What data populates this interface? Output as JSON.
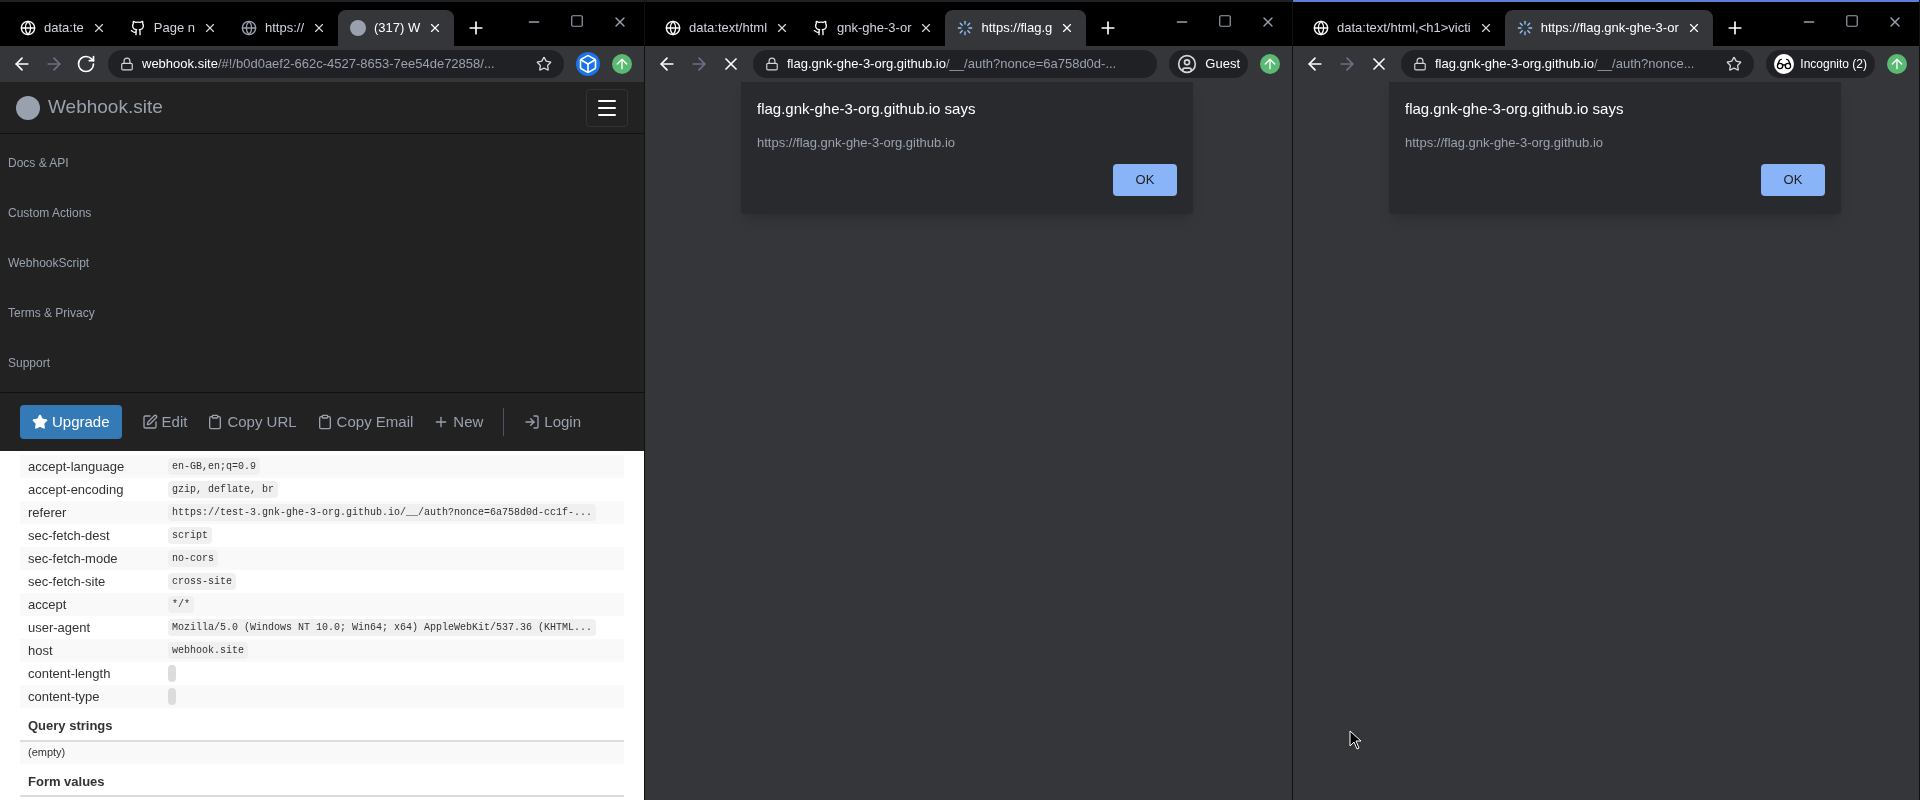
{
  "windows": [
    {
      "kind": "webhook",
      "accent": false,
      "tabs": [
        {
          "kind": "globe",
          "title": "data:te",
          "selected": false
        },
        {
          "kind": "github",
          "title": "Page n",
          "selected": false
        },
        {
          "kind": "globe-dim",
          "title": "https://",
          "selected": false
        },
        {
          "kind": "webhook",
          "title": "(317) W",
          "selected": true
        }
      ],
      "address": {
        "host": "webhook.site",
        "path": "/#!/b0d0aef2-662c-4527-8653-7ee54de72858/...",
        "loading": false,
        "bookmark": true
      },
      "profile": {
        "kind": "extension"
      },
      "page": {
        "brand": "Webhook.site",
        "menu": [
          "Docs & API",
          "Custom Actions",
          "WebhookScript",
          "Terms & Privacy",
          "Support"
        ],
        "toolbar": [
          {
            "kind": "upgrade",
            "label": "Upgrade"
          },
          {
            "kind": "edit",
            "label": "Edit"
          },
          {
            "kind": "copy",
            "label": "Copy URL"
          },
          {
            "kind": "copy",
            "label": "Copy Email"
          },
          {
            "kind": "new",
            "label": "New"
          },
          {
            "kind": "divider"
          },
          {
            "kind": "login",
            "label": "Login"
          }
        ],
        "headers": [
          {
            "name": "accept-language",
            "value": "en-GB,en;q=0.9"
          },
          {
            "name": "accept-encoding",
            "value": "gzip, deflate, br"
          },
          {
            "name": "referer",
            "value": "https://test-3.gnk-ghe-3-org.github.io/__/auth?nonce=6a758d0d-cc1f-..."
          },
          {
            "name": "sec-fetch-dest",
            "value": "script"
          },
          {
            "name": "sec-fetch-mode",
            "value": "no-cors"
          },
          {
            "name": "sec-fetch-site",
            "value": "cross-site"
          },
          {
            "name": "accept",
            "value": "*/*"
          },
          {
            "name": "user-agent",
            "value": "Mozilla/5.0 (Windows NT 10.0; Win64; x64) AppleWebKit/537.36 (KHTML..."
          },
          {
            "name": "host",
            "value": "webhook.site"
          },
          {
            "name": "content-length"
          },
          {
            "name": "content-type"
          }
        ],
        "sections": [
          {
            "title": "Query strings",
            "body": "(empty)"
          },
          {
            "title": "Form values"
          }
        ]
      }
    },
    {
      "kind": "dialog",
      "accent": false,
      "tabs": [
        {
          "kind": "globe",
          "title": "data:text/html",
          "selected": false
        },
        {
          "kind": "github",
          "title": "gnk-ghe-3-or",
          "selected": false
        },
        {
          "kind": "loading",
          "title": "https://flag.g",
          "selected": true
        }
      ],
      "address": {
        "host": "flag.gnk-ghe-3-org.github.io",
        "path": "/__/auth?nonce=6a758d0d-...",
        "loading": true,
        "bookmark": false
      },
      "profile": {
        "kind": "guest",
        "label": "Guest"
      },
      "dialog": {
        "title": "flag.gnk-ghe-3-org.github.io says",
        "message": "https://flag.gnk-ghe-3-org.github.io",
        "button": "OK"
      }
    },
    {
      "kind": "dialog",
      "accent": true,
      "tabs": [
        {
          "kind": "globe",
          "title": "data:text/html,<h1>victi",
          "selected": false
        },
        {
          "kind": "loading",
          "title": "https://flag.gnk-ghe-3-or",
          "selected": true
        }
      ],
      "address": {
        "host": "flag.gnk-ghe-3-org.github.io",
        "path": "/__/auth?nonce...",
        "loading": true,
        "bookmark": true
      },
      "profile": {
        "kind": "incognito",
        "label": "Incognito (2)"
      },
      "dialog": {
        "title": "flag.gnk-ghe-3-org.github.io says",
        "message": "https://flag.gnk-ghe-3-org.github.io",
        "button": "OK"
      },
      "cursor": true
    }
  ]
}
